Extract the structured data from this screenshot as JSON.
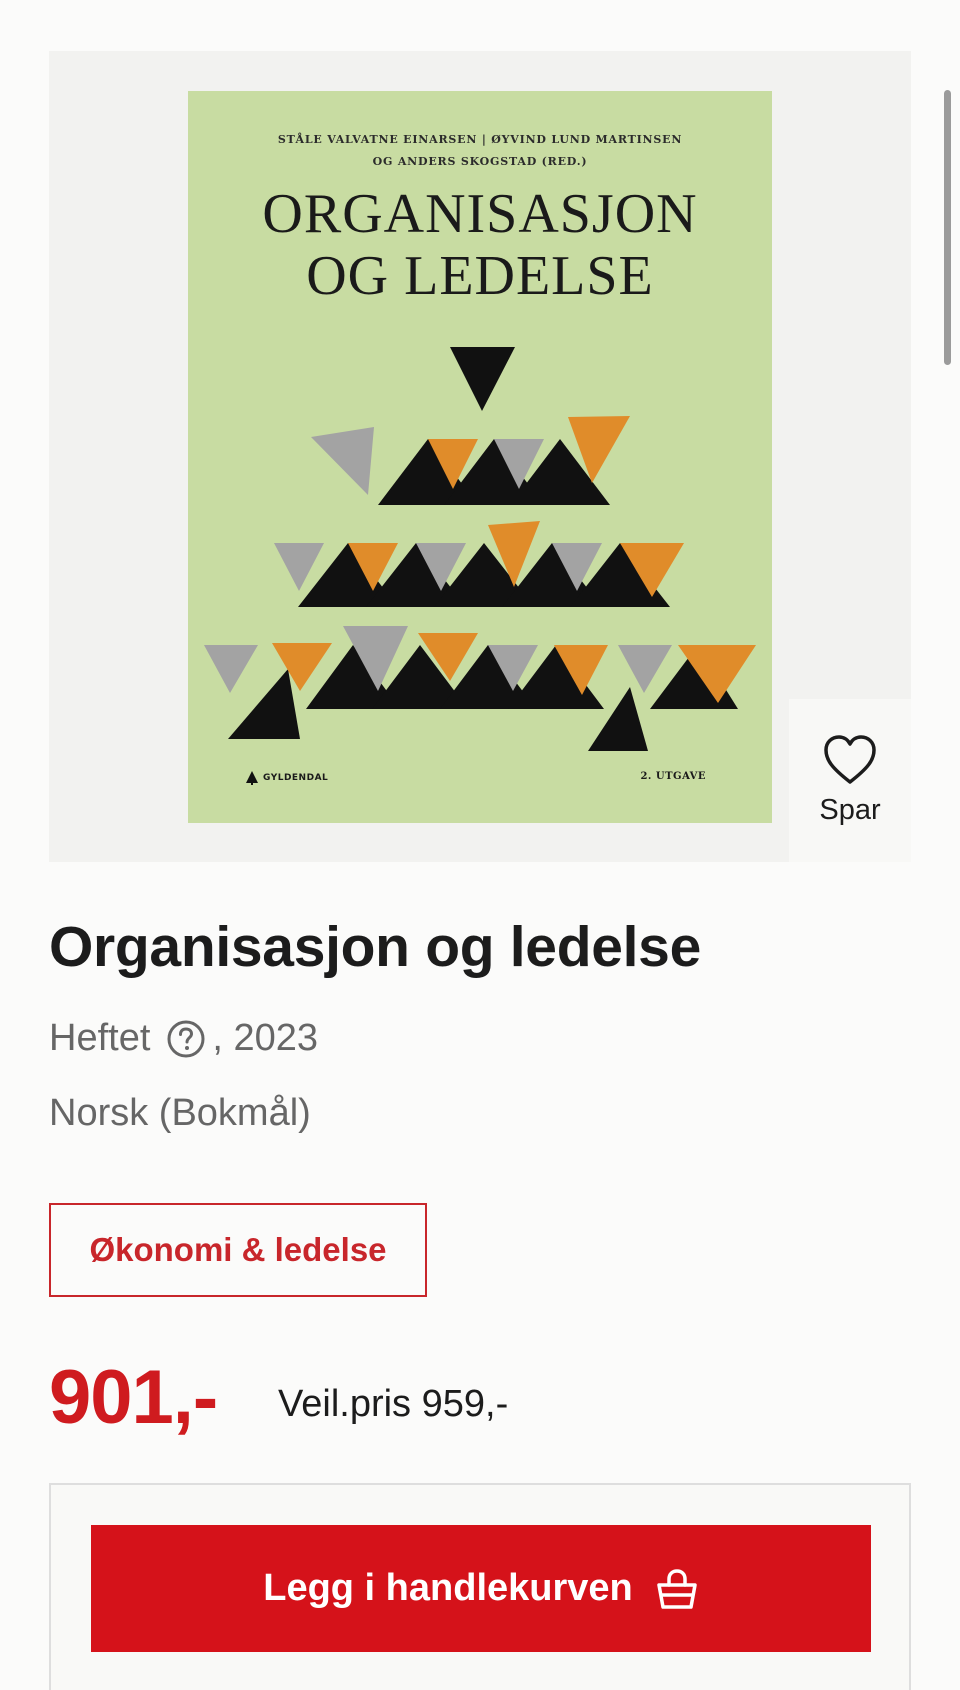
{
  "cover": {
    "authors_line1": "STÅLE VALVATNE EINARSEN  |  ØYVIND LUND MARTINSEN",
    "authors_line2": "OG ANDERS SKOGSTAD (RED.)",
    "title_line1": "ORGANISASJON",
    "title_line2": "OG LEDELSE",
    "publisher": "GYLDENDAL",
    "edition": "2. UTGAVE",
    "background_color": "#c8dca2"
  },
  "favorite": {
    "label": "Spar",
    "icon": "heart-icon"
  },
  "product": {
    "title": "Organisasjon og ledelse",
    "format": "Heftet",
    "format_help_icon": "question-circle-icon",
    "year": ", 2023",
    "language": "Norsk (Bokmål)",
    "category": "Økonomi & ledelse"
  },
  "pricing": {
    "price": "901,-",
    "list_price": "Veil.pris 959,-"
  },
  "cart": {
    "button_label": "Legg i handlekurven",
    "icon": "basket-icon"
  },
  "colors": {
    "brand_red": "#d5121a",
    "price_red": "#cf1b1f",
    "tag_red": "#c8262b"
  }
}
